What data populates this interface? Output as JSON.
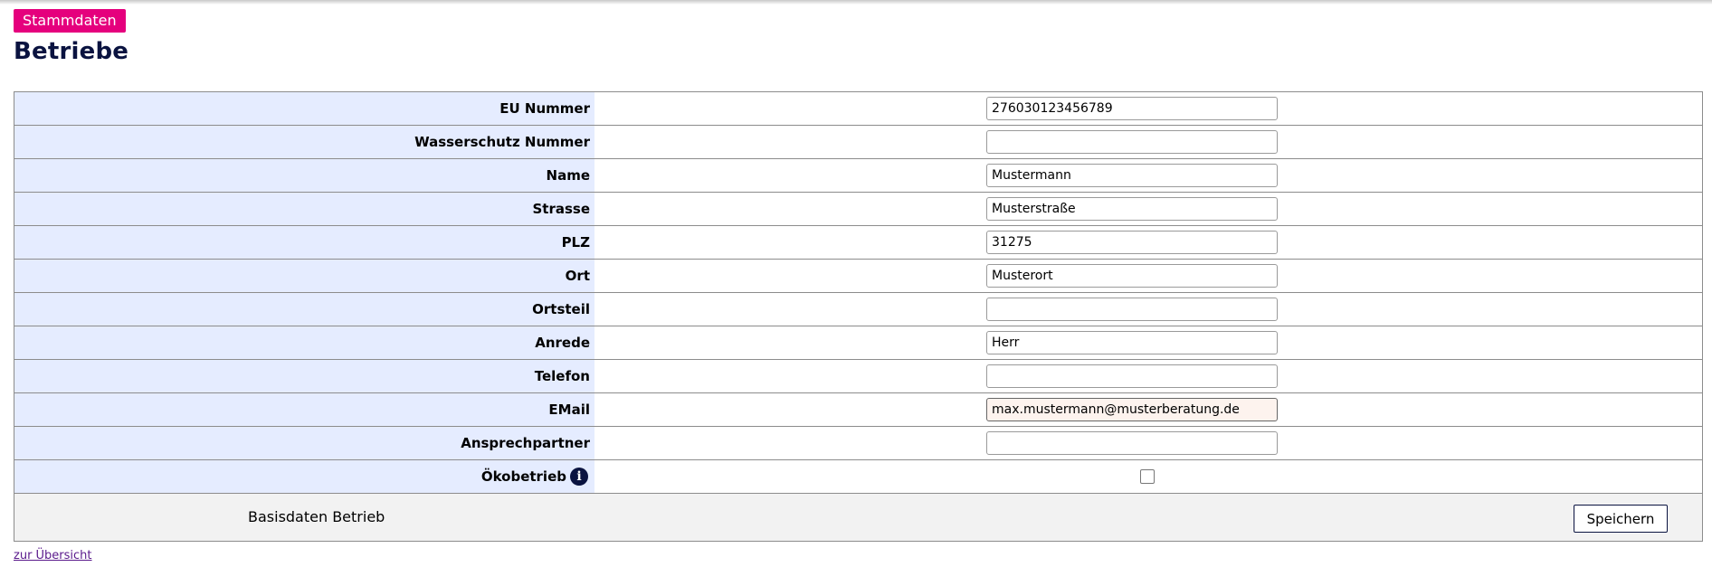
{
  "header": {
    "badge": "Stammdaten",
    "title": "Betriebe"
  },
  "form": {
    "rows": [
      {
        "label": "EU Nummer",
        "value": "276030123456789"
      },
      {
        "label": "Wasserschutz Nummer",
        "value": ""
      },
      {
        "label": "Name",
        "value": "Mustermann"
      },
      {
        "label": "Strasse",
        "value": "Musterstraße"
      },
      {
        "label": "PLZ",
        "value": "31275"
      },
      {
        "label": "Ort",
        "value": "Musterort"
      },
      {
        "label": "Ortsteil",
        "value": ""
      },
      {
        "label": "Anrede",
        "value": "Herr"
      },
      {
        "label": "Telefon",
        "value": ""
      },
      {
        "label": "EMail",
        "value": "max.mustermann@musterberatung.de"
      },
      {
        "label": "Ansprechpartner",
        "value": ""
      }
    ],
    "oeko": {
      "label": "Ökobetrieb",
      "info_icon": "info-icon",
      "checked": false
    }
  },
  "footer": {
    "label": "Basisdaten Betrieb",
    "save_label": "Speichern"
  },
  "links": {
    "overview": "zur Übersicht"
  },
  "colors": {
    "badge": "#e5007d",
    "title": "#0a1340",
    "label_bg": "#e5ecff",
    "footer_bg": "#f2f2f2"
  }
}
